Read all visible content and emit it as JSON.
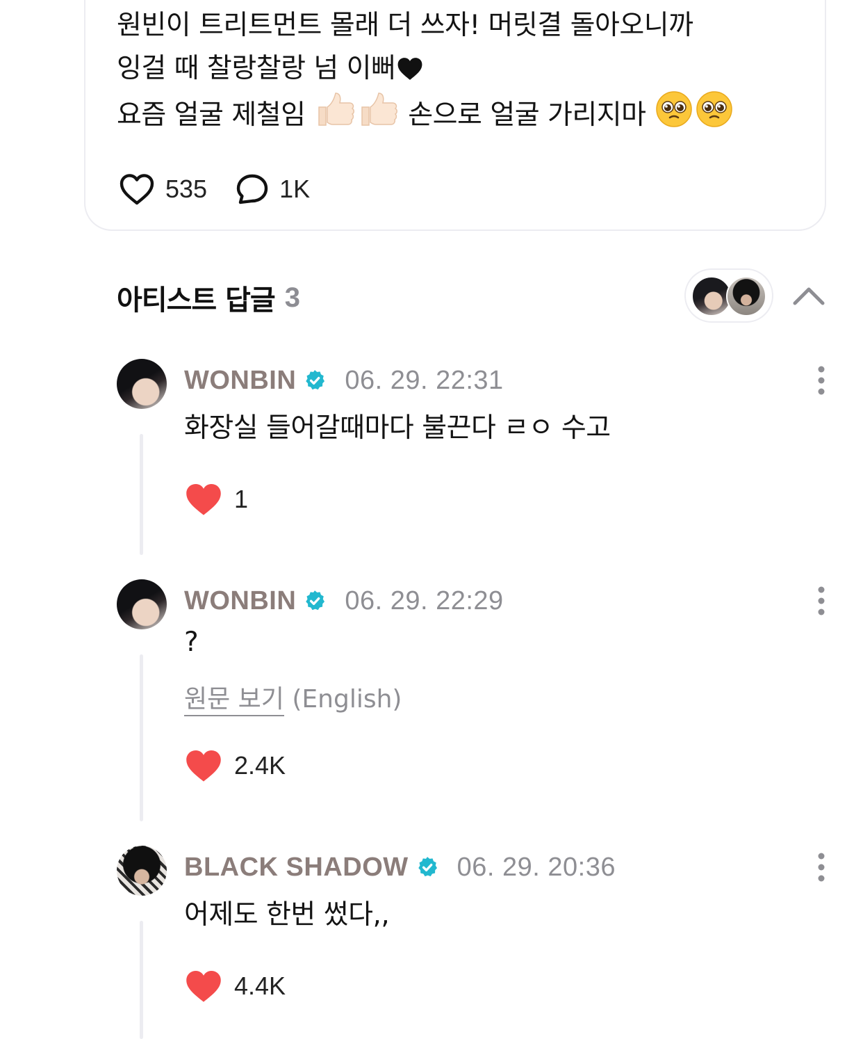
{
  "post": {
    "lines": [
      "원빈이 트리트먼트 몰래 더 쓰자! 머릿결 돌아오니까",
      "잉걸 때 찰랑찰랑 넘 이뻐",
      "요즘 얼굴 제철임",
      "손으로 얼굴 가리지마"
    ],
    "like_count": "535",
    "reply_count": "1K"
  },
  "artist_replies": {
    "title": "아티스트 답글",
    "count": "3"
  },
  "comments": [
    {
      "author": "WONBIN",
      "time": "06. 29. 22:31",
      "text": "화장실 들어갈때마다 불끈다 ㄹㅇ 수고",
      "likes": "1"
    },
    {
      "author": "WONBIN",
      "time": "06. 29. 22:29",
      "text": "?",
      "translate_link": "원문 보기",
      "translate_lang": " (English)",
      "likes": "2.4K"
    },
    {
      "author": "BLACK SHADOW",
      "time": "06. 29. 20:36",
      "text": "어제도 한번 썼다,,",
      "likes": "4.4K"
    }
  ],
  "colors": {
    "heart_red": "#f44b4b",
    "verified_teal": "#22b8cf",
    "author_name": "#8b7d7a",
    "muted": "#8e8e93",
    "divider": "#ececf1"
  },
  "icons": [
    "heart-outline-icon",
    "comment-bubble-icon",
    "heart-filled-icon",
    "verified-badge-icon",
    "more-vertical-icon",
    "chevron-up-icon",
    "thumbs-up-icon",
    "pleading-face-icon",
    "black-heart-icon"
  ]
}
